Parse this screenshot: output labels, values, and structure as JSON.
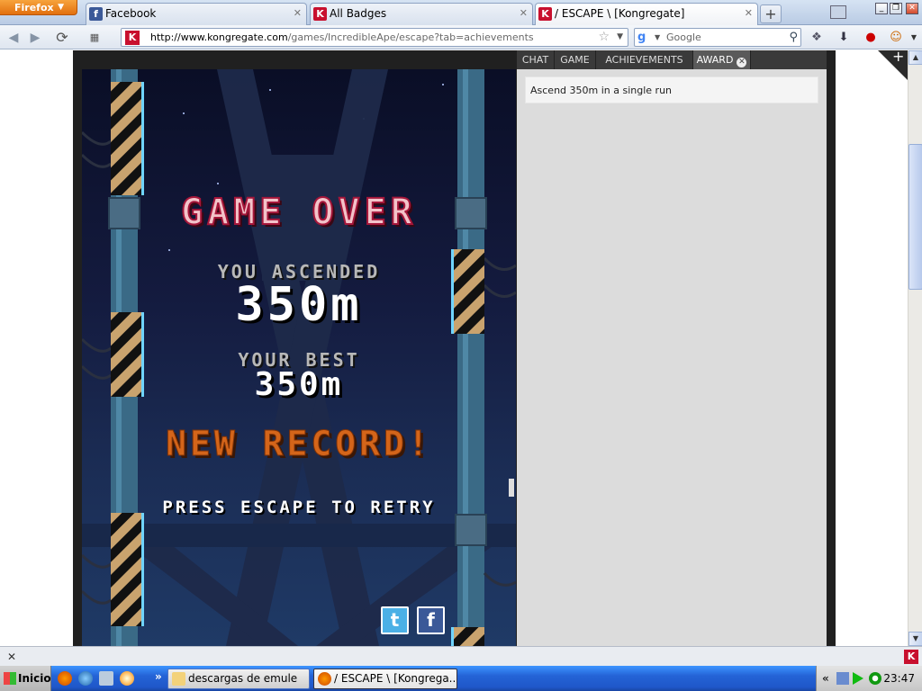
{
  "browser": {
    "menu_button": "Firefox",
    "tabs": [
      {
        "label": "Facebook",
        "icon": "facebook-icon",
        "active": false
      },
      {
        "label": "All Badges",
        "icon": "kongregate-icon",
        "active": false
      },
      {
        "label": "/ ESCAPE \\ [Kongregate]",
        "icon": "kongregate-icon",
        "active": true
      }
    ],
    "url_host": "http://www.kongregate.com",
    "url_path": "/games/IncredibleApe/escape?tab=achievements",
    "search_placeholder": "Google",
    "favicon_letter": "K",
    "search_engine_letter": "g"
  },
  "game": {
    "title": "GAME OVER",
    "ascended_label": "YOU ASCENDED",
    "ascended_value": "350m",
    "best_label": "YOUR BEST",
    "best_value": "350m",
    "new_record": "NEW RECORD!",
    "retry_hint": "PRESS ESCAPE TO RETRY",
    "twitter_letter": "t",
    "facebook_letter": "f"
  },
  "sidebar": {
    "tabs": [
      "CHAT",
      "GAME",
      "ACHIEVEMENTS",
      "AWARD"
    ],
    "active_tab": "AWARD",
    "award_text": "Ascend 350m in a single run"
  },
  "taskbar": {
    "start_label": "Inicio",
    "tasks": [
      {
        "label": "descargas de emule",
        "active": false
      },
      {
        "label": "/ ESCAPE \\ [Kongrega...",
        "active": true
      }
    ],
    "clock": "23:47"
  },
  "colors": {
    "kongregate_red": "#c8102e",
    "game_over_red": "#a5163a",
    "new_record_orange": "#d4651a",
    "xp_blue": "#2463d6"
  }
}
